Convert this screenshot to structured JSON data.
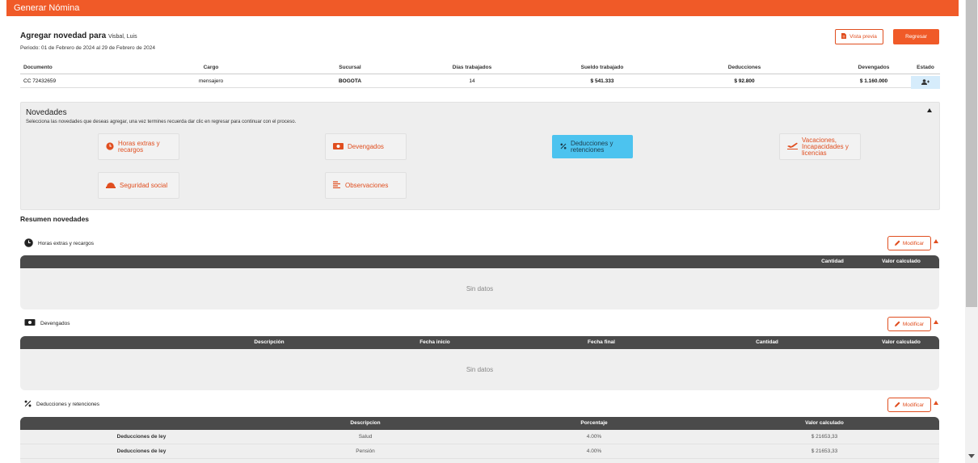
{
  "header": {
    "title": "Generar Nómina"
  },
  "employee": {
    "title_prefix": "Agregar novedad para",
    "name": "Visbal, Luis",
    "period": "Periodo: 01 de Febrero de 2024 al 29 de Febrero de 2024"
  },
  "actions": {
    "preview_label": "Vista previa",
    "back_label": "Regresar"
  },
  "emp_table": {
    "headers": [
      "Documento",
      "Cargo",
      "Sucursal",
      "Días trabajados",
      "Sueldo trabajado",
      "Deducciones",
      "Devengados",
      "Estado"
    ],
    "row": [
      "CC 72432659",
      "mensajero",
      "BOGOTA",
      "14",
      "$ 541.333",
      "$ 92.800",
      "$ 1.160.000"
    ]
  },
  "novedades": {
    "title": "Novedades",
    "subtitle": "Selecciona las novedades que deseas agregar, una vez termines recuerda dar clic en regresar para continuar con el proceso.",
    "buttons": {
      "horas": "Horas extras y recargos",
      "devengados": "Devengados",
      "deducciones": "Deducciones y retenciones",
      "vacaciones": "Vacaciones, Incapacidades y licencias",
      "seguridad": "Seguridad social",
      "observaciones": "Observaciones"
    }
  },
  "resumen": {
    "title": "Resumen novedades",
    "modify_label": "Modificar",
    "empty_text": "Sin datos",
    "horas": {
      "label": "Horas extras y recargos",
      "headers": [
        "Cantidad",
        "Valor calculado"
      ]
    },
    "devengados": {
      "label": "Devengados",
      "headers": [
        "Descripción",
        "Fecha inicio",
        "Fecha final",
        "Cantidad",
        "Valor calculado"
      ]
    },
    "deducciones": {
      "label": "Deducciones y retenciones",
      "headers": [
        "Descripcion",
        "Porcentaje",
        "Valor calculado"
      ],
      "rows": [
        {
          "group": "Deducciones de ley",
          "desc": "Salud",
          "pct": "4.00%",
          "value": "$ 21653,33"
        },
        {
          "group": "Deducciones de ley",
          "desc": "Pensión",
          "pct": "4.00%",
          "value": "$ 21653,33"
        }
      ]
    }
  },
  "colors": {
    "brand": "#f05a28",
    "active": "#4cc3ef",
    "table_head": "#4a4a4a"
  },
  "icons": [
    "clock-icon",
    "money-icon",
    "percent-icon",
    "plane-icon",
    "helmet-icon",
    "list-icon",
    "pencil-icon",
    "document-icon",
    "user-icon"
  ]
}
